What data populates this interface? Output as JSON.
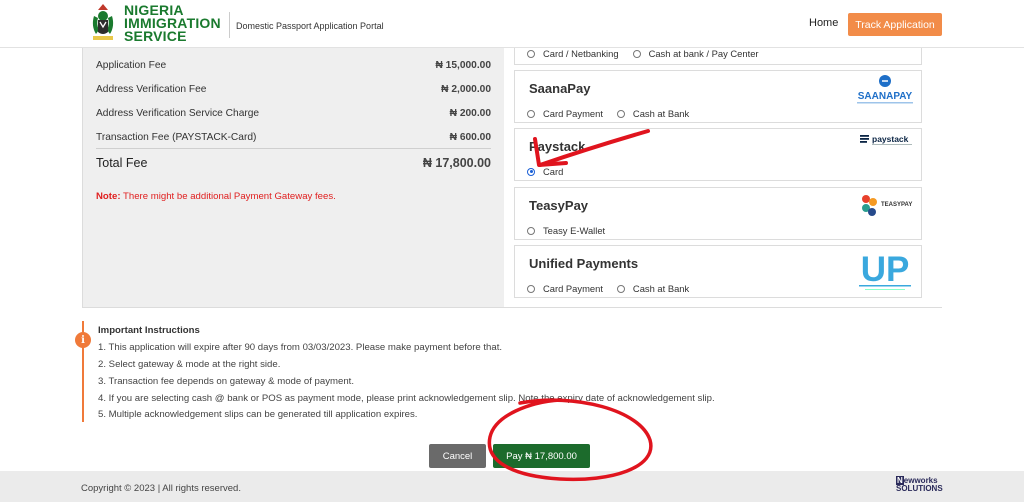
{
  "header": {
    "logo_lines": [
      "NIGERIA",
      "IMMIGRATION",
      "SERVICE"
    ],
    "portal_name": "Domestic Passport Application Portal",
    "nav_home": "Home",
    "nav_track": "Track Application"
  },
  "fees": {
    "rows": [
      {
        "label": "Application Fee",
        "amount": "₦ 15,000.00"
      },
      {
        "label": "Address Verification Fee",
        "amount": "₦ 2,000.00"
      },
      {
        "label": "Address Verification Service Charge",
        "amount": "₦ 200.00"
      },
      {
        "label": "Transaction Fee (PAYSTACK-Card)",
        "amount": "₦ 600.00"
      }
    ],
    "total_label": "Total Fee",
    "total_amount": "₦ 17,800.00",
    "note_prefix": "Note:",
    "note_text": " There might be additional Payment Gateway fees."
  },
  "gateways": [
    {
      "title": "",
      "options": [
        {
          "label": "Card / Netbanking",
          "selected": false
        },
        {
          "label": "Cash at bank / Pay Center",
          "selected": false
        }
      ]
    },
    {
      "title": "SaanaPay",
      "logo": "SAANAPAY",
      "options": [
        {
          "label": "Card Payment",
          "selected": false
        },
        {
          "label": "Cash at Bank",
          "selected": false
        }
      ]
    },
    {
      "title": "Paystack",
      "logo": "paystack",
      "options": [
        {
          "label": "Card",
          "selected": true
        }
      ]
    },
    {
      "title": "TeasyPay",
      "logo": "TEASYPAY",
      "options": [
        {
          "label": "Teasy E-Wallet",
          "selected": false
        }
      ]
    },
    {
      "title": "Unified Payments",
      "logo": "UP",
      "options": [
        {
          "label": "Card Payment",
          "selected": false
        },
        {
          "label": "Cash at Bank",
          "selected": false
        }
      ]
    }
  ],
  "instructions": {
    "icon": "info-icon",
    "title": "Important Instructions",
    "lines": [
      "1. This application will expire after 90 days from 03/03/2023. Please make payment before that.",
      "2. Select gateway & mode at the right side.",
      "3. Transaction fee depends on gateway & mode of payment.",
      "4. If you are selecting cash @ bank or POS as payment mode, please print acknowledgement slip. Note the expiry date of acknowledgement slip.",
      "5. Multiple acknowledgement slips can be generated till application expires."
    ]
  },
  "buttons": {
    "cancel": "Cancel",
    "pay": "Pay ₦ 17,800.00"
  },
  "footer": {
    "copyright": "Copyright © 2023 | All rights reserved.",
    "vendor_line1": "ewworks",
    "vendor_line2": "SOLUTIONS",
    "vendor_n": "N"
  },
  "colors": {
    "brand_green": "#1a7a2e",
    "accent_orange": "#f28c49",
    "pay_green": "#1c6b2c",
    "annotation_red": "#e0141e",
    "note_red": "#e02020"
  }
}
